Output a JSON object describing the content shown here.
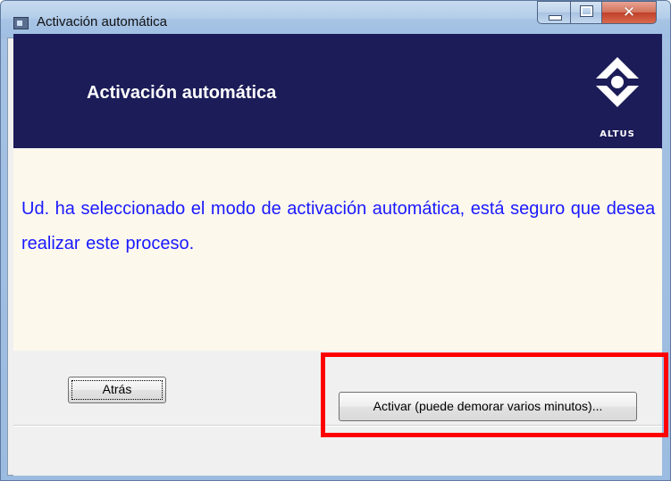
{
  "window": {
    "title": "Activación automática",
    "controls": {
      "minimize": "minimize",
      "maximize": "maximize",
      "close": "✕"
    }
  },
  "header": {
    "title": "Activación automática",
    "logo_text": "ALTUS"
  },
  "content": {
    "message": "Ud. ha seleccionado el modo de activación  automática,  está seguro que desea realizar este proceso."
  },
  "buttons": {
    "back_label": "Atrás",
    "activate_label": "Activar (puede demorar varios minutos)..."
  },
  "colors": {
    "header_bg": "#1c1c59",
    "message_text": "#1a1aff",
    "content_bg": "#fdf8ec",
    "highlight": "#ff0000"
  }
}
